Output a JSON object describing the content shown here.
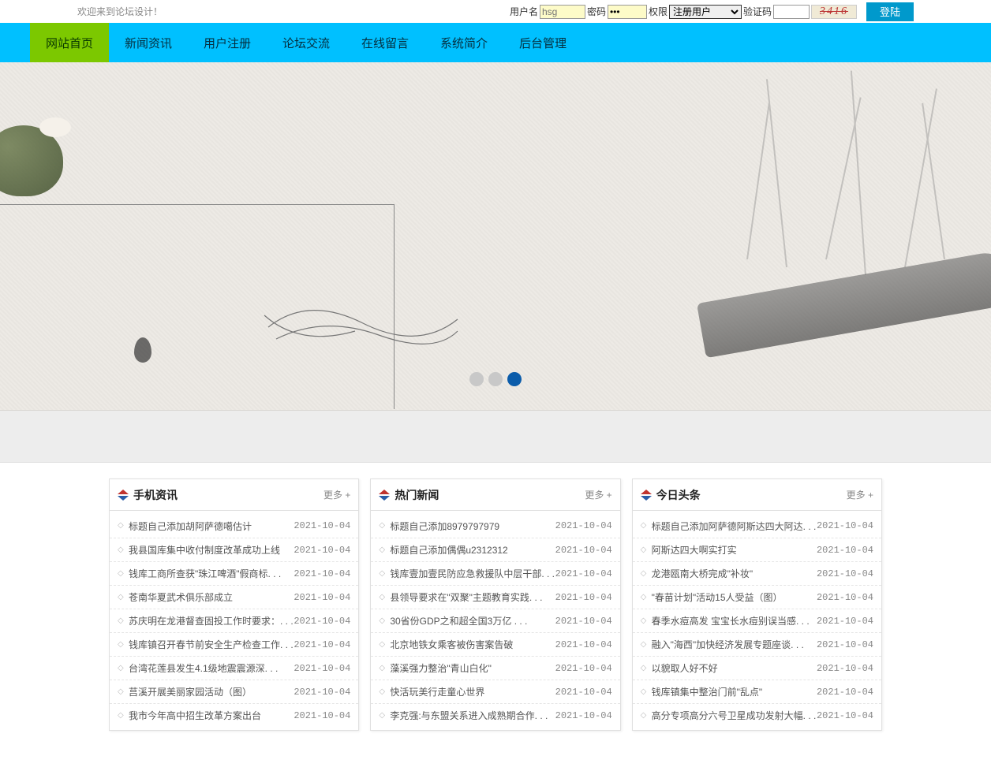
{
  "topbar": {
    "welcome": "欢迎来到论坛设计！",
    "username_label": "用户名",
    "username_placeholder": "hsg",
    "password_label": "密码",
    "password_value": "•••",
    "role_label": "权限",
    "role_selected": "注册用户",
    "captcha_label": "验证码",
    "captcha_value": "3416",
    "login_btn": "登陆"
  },
  "nav": {
    "items": [
      "网站首页",
      "新闻资讯",
      "用户注册",
      "论坛交流",
      "在线留言",
      "系统简介",
      "后台管理"
    ],
    "active_index": 0
  },
  "banner": {
    "dots": 3,
    "active_dot": 2
  },
  "columns": [
    {
      "title": "手机资讯",
      "more": "更多 +",
      "items": [
        {
          "t": "标题自己添加胡阿萨德噶估计",
          "d": "2021-10-04"
        },
        {
          "t": "我县国库集中收付制度改革成功上线",
          "d": "2021-10-04"
        },
        {
          "t": "钱库工商所查获\"珠江啤酒\"假商标. . .",
          "d": "2021-10-04"
        },
        {
          "t": "苍南华夏武术俱乐部成立",
          "d": "2021-10-04"
        },
        {
          "t": "苏庆明在龙港督查固投工作时要求：. . .",
          "d": "2021-10-04"
        },
        {
          "t": "钱库镇召开春节前安全生产检查工作. . .",
          "d": "2021-10-04"
        },
        {
          "t": "台湾花莲县发生4.1级地震震源深. . .",
          "d": "2021-10-04"
        },
        {
          "t": "莒溪开展美丽家园活动（图）",
          "d": "2021-10-04"
        },
        {
          "t": "我市今年高中招生改革方案出台",
          "d": "2021-10-04"
        }
      ]
    },
    {
      "title": "热门新闻",
      "more": "更多 +",
      "items": [
        {
          "t": "标题自己添加8979797979",
          "d": "2021-10-04"
        },
        {
          "t": "标题自己添加偶偶u2312312",
          "d": "2021-10-04"
        },
        {
          "t": "钱库壹加壹民防应急救援队中层干部. . .",
          "d": "2021-10-04"
        },
        {
          "t": "县领导要求在\"双聚\"主题教育实践. . .",
          "d": "2021-10-04"
        },
        {
          "t": "30省份GDP之和超全国3万亿 . . .",
          "d": "2021-10-04"
        },
        {
          "t": "北京地铁女乘客被伤害案告破",
          "d": "2021-10-04"
        },
        {
          "t": "藻溪强力整治\"青山白化\"",
          "d": "2021-10-04"
        },
        {
          "t": "快活玩美行走童心世界",
          "d": "2021-10-04"
        },
        {
          "t": "李克强:与东盟关系进入成熟期合作. . .",
          "d": "2021-10-04"
        }
      ]
    },
    {
      "title": "今日头条",
      "more": "更多 +",
      "items": [
        {
          "t": "标题自己添加阿萨德阿斯达四大阿达. . .",
          "d": "2021-10-04"
        },
        {
          "t": "阿斯达四大啊实打实",
          "d": "2021-10-04"
        },
        {
          "t": "龙港瓯南大桥完成\"补妆\"",
          "d": "2021-10-04"
        },
        {
          "t": "\"春苗计划\"活动15人受益（图）",
          "d": "2021-10-04"
        },
        {
          "t": "春季水痘高发 宝宝长水痘别误当感. . .",
          "d": "2021-10-04"
        },
        {
          "t": "融入\"海西\"加快经济发展专题座谈. . .",
          "d": "2021-10-04"
        },
        {
          "t": "以貌取人好不好",
          "d": "2021-10-04"
        },
        {
          "t": "钱库镇集中整治门前\"乱点\"",
          "d": "2021-10-04"
        },
        {
          "t": "高分专项高分六号卫星成功发射大幅. . .",
          "d": "2021-10-04"
        }
      ]
    }
  ]
}
